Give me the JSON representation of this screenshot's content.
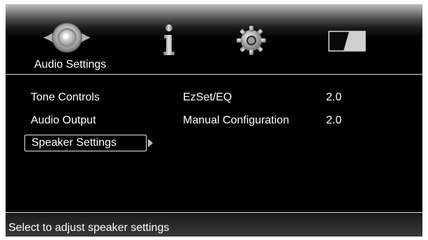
{
  "header": {
    "active_tab_label": "Audio Settings",
    "tabs": [
      {
        "icon": "speaker-icon",
        "label": "Audio Settings"
      },
      {
        "icon": "info-icon"
      },
      {
        "icon": "gear-icon"
      },
      {
        "icon": "display-aspect-icon"
      }
    ]
  },
  "menu": {
    "items": [
      {
        "label": "Tone Controls"
      },
      {
        "label": "Audio Output"
      },
      {
        "label": "Speaker Settings",
        "selected": true
      }
    ]
  },
  "settings": [
    {
      "name": "EzSet/EQ",
      "value": "2.0"
    },
    {
      "name": "Manual Configuration",
      "value": "2.0"
    }
  ],
  "status": {
    "text": "Select to adjust speaker settings"
  },
  "colors": {
    "background": "#000000",
    "text": "#ffffff",
    "divider": "#d8d8d8"
  }
}
